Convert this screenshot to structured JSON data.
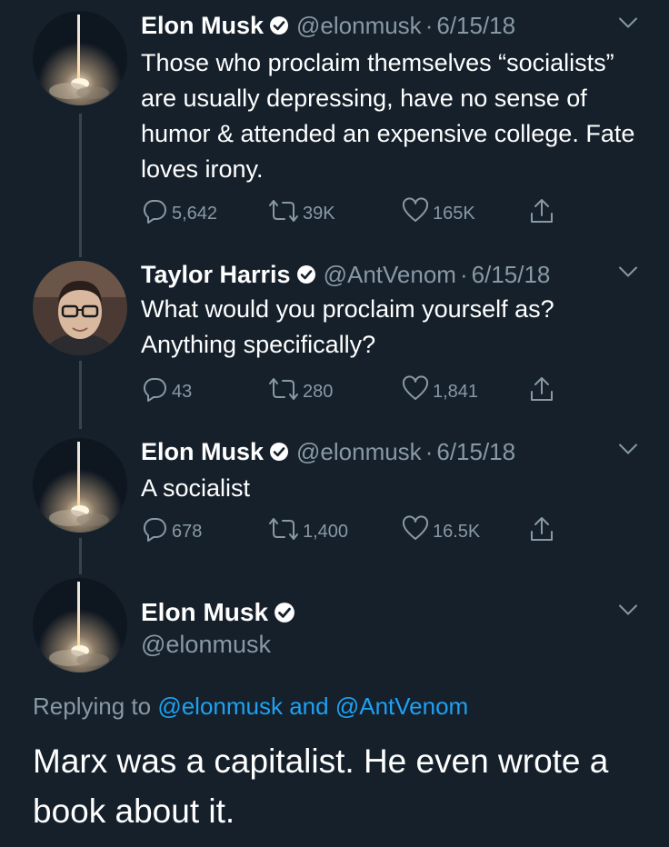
{
  "tweets": [
    {
      "name": "Elon Musk",
      "handle": "@elonmusk",
      "separator": "·",
      "date": "6/15/18",
      "text": "Those who proclaim themselves “socialists” are usually depressing, have no sense of humor & attended an expensive college. Fate loves irony.",
      "replies": "5,642",
      "retweets": "39K",
      "likes": "165K"
    },
    {
      "name": "Taylor Harris",
      "handle": "@AntVenom",
      "separator": "·",
      "date": "6/15/18",
      "text": "What would you proclaim yourself as? Anything specifically?",
      "replies": "43",
      "retweets": "280",
      "likes": "1,841"
    },
    {
      "name": "Elon Musk",
      "handle": "@elonmusk",
      "separator": "·",
      "date": "6/15/18",
      "text": "A socialist",
      "replies": "678",
      "retweets": "1,400",
      "likes": "16.5K"
    }
  ],
  "main_tweet": {
    "name": "Elon Musk",
    "handle": "@elonmusk",
    "replying_prefix": "Replying to",
    "reply_mention_1": "@elonmusk",
    "reply_conjunction": "and",
    "reply_mention_2": "@AntVenom",
    "text": "Marx was a capitalist. He even wrote a book about it."
  },
  "colors": {
    "background": "#15202b",
    "text": "#ffffff",
    "secondary": "#8899a6",
    "accent": "#1da1f2",
    "thread_line": "#38444d"
  },
  "icons": [
    "rocket-launch-avatar",
    "person-glasses-avatar",
    "verified-badge-icon",
    "chevron-down-icon",
    "reply-icon",
    "retweet-icon",
    "like-icon",
    "share-icon"
  ]
}
